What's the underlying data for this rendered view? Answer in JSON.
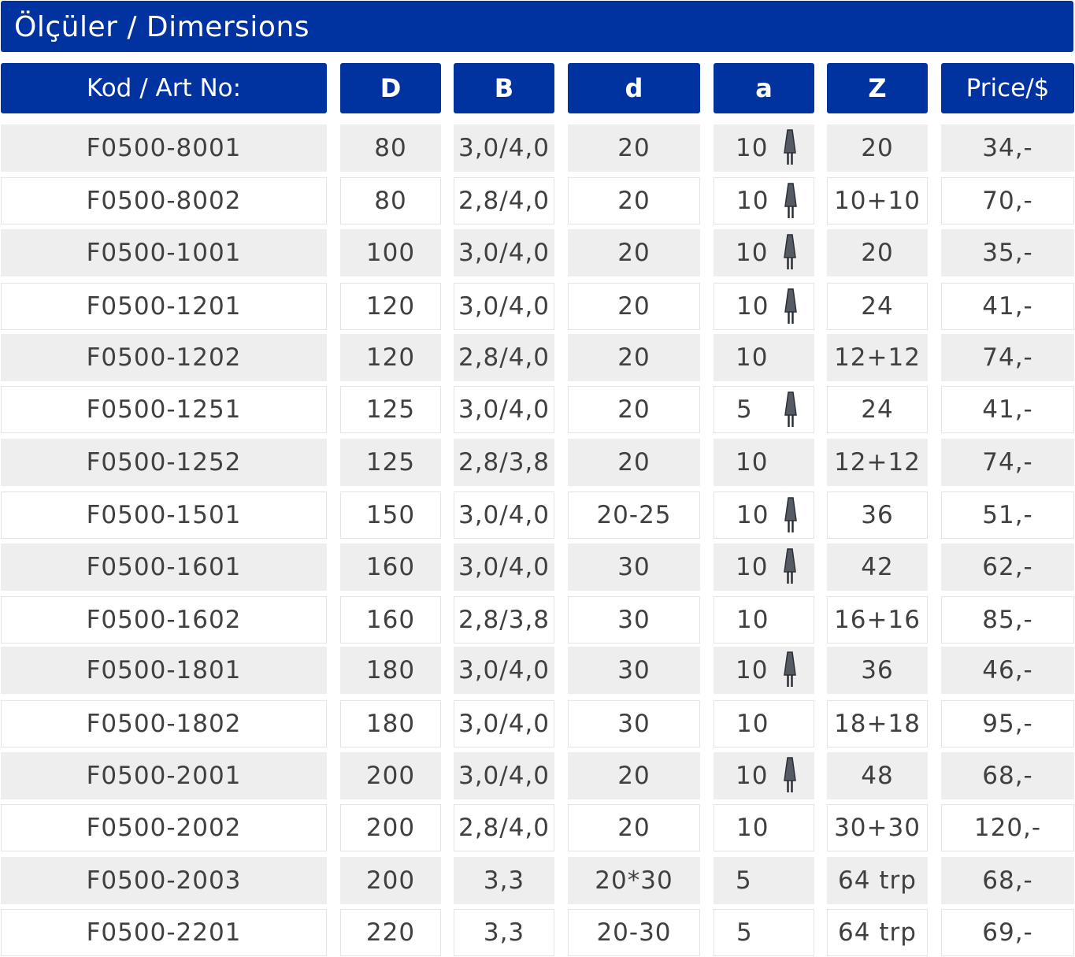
{
  "title": "Ölçüler / Dimersions",
  "headers": {
    "code": "Kod / Art No:",
    "D": "D",
    "B": "B",
    "d": "d",
    "a": "a",
    "Z": "Z",
    "price": "Price/$"
  },
  "rows": [
    {
      "code": "F0500-8001",
      "D": "80",
      "B": "3,0/4,0",
      "d": "20",
      "a": "10",
      "tooth_icon": true,
      "Z": "20",
      "price": "34,-"
    },
    {
      "code": "F0500-8002",
      "D": "80",
      "B": "2,8/4,0",
      "d": "20",
      "a": "10",
      "tooth_icon": true,
      "Z": "10+10",
      "price": "70,-"
    },
    {
      "code": "F0500-1001",
      "D": "100",
      "B": "3,0/4,0",
      "d": "20",
      "a": "10",
      "tooth_icon": true,
      "Z": "20",
      "price": "35,-"
    },
    {
      "code": "F0500-1201",
      "D": "120",
      "B": "3,0/4,0",
      "d": "20",
      "a": "10",
      "tooth_icon": true,
      "Z": "24",
      "price": "41,-"
    },
    {
      "code": "F0500-1202",
      "D": "120",
      "B": "2,8/4,0",
      "d": "20",
      "a": "10",
      "tooth_icon": false,
      "Z": "12+12",
      "price": "74,-"
    },
    {
      "code": "F0500-1251",
      "D": "125",
      "B": "3,0/4,0",
      "d": "20",
      "a": "5",
      "tooth_icon": true,
      "Z": "24",
      "price": "41,-"
    },
    {
      "code": "F0500-1252",
      "D": "125",
      "B": "2,8/3,8",
      "d": "20",
      "a": "10",
      "tooth_icon": false,
      "Z": "12+12",
      "price": "74,-"
    },
    {
      "code": "F0500-1501",
      "D": "150",
      "B": "3,0/4,0",
      "d": "20-25",
      "a": "10",
      "tooth_icon": true,
      "Z": "36",
      "price": "51,-"
    },
    {
      "code": "F0500-1601",
      "D": "160",
      "B": "3,0/4,0",
      "d": "30",
      "a": "10",
      "tooth_icon": true,
      "Z": "42",
      "price": "62,-"
    },
    {
      "code": "F0500-1602",
      "D": "160",
      "B": "2,8/3,8",
      "d": "30",
      "a": "10",
      "tooth_icon": false,
      "Z": "16+16",
      "price": "85,-"
    },
    {
      "code": "F0500-1801",
      "D": "180",
      "B": "3,0/4,0",
      "d": "30",
      "a": "10",
      "tooth_icon": true,
      "Z": "36",
      "price": "46,-"
    },
    {
      "code": "F0500-1802",
      "D": "180",
      "B": "3,0/4,0",
      "d": "30",
      "a": "10",
      "tooth_icon": false,
      "Z": "18+18",
      "price": "95,-"
    },
    {
      "code": "F0500-2001",
      "D": "200",
      "B": "3,0/4,0",
      "d": "20",
      "a": "10",
      "tooth_icon": true,
      "Z": "48",
      "price": "68,-"
    },
    {
      "code": "F0500-2002",
      "D": "200",
      "B": "2,8/4,0",
      "d": "20",
      "a": "10",
      "tooth_icon": false,
      "Z": "30+30",
      "price": "120,-"
    },
    {
      "code": "F0500-2003",
      "D": "200",
      "B": "3,3",
      "d": "20*30",
      "a": "5",
      "tooth_icon": false,
      "Z": "64 trp",
      "price": "68,-"
    },
    {
      "code": "F0500-2201",
      "D": "220",
      "B": "3,3",
      "d": "20-30",
      "a": "5",
      "tooth_icon": false,
      "Z": "64 trp",
      "price": "69,-"
    }
  ],
  "colors": {
    "header_blue": "#0033a0",
    "row_shaded": "#eeeeee",
    "text": "#404040"
  }
}
